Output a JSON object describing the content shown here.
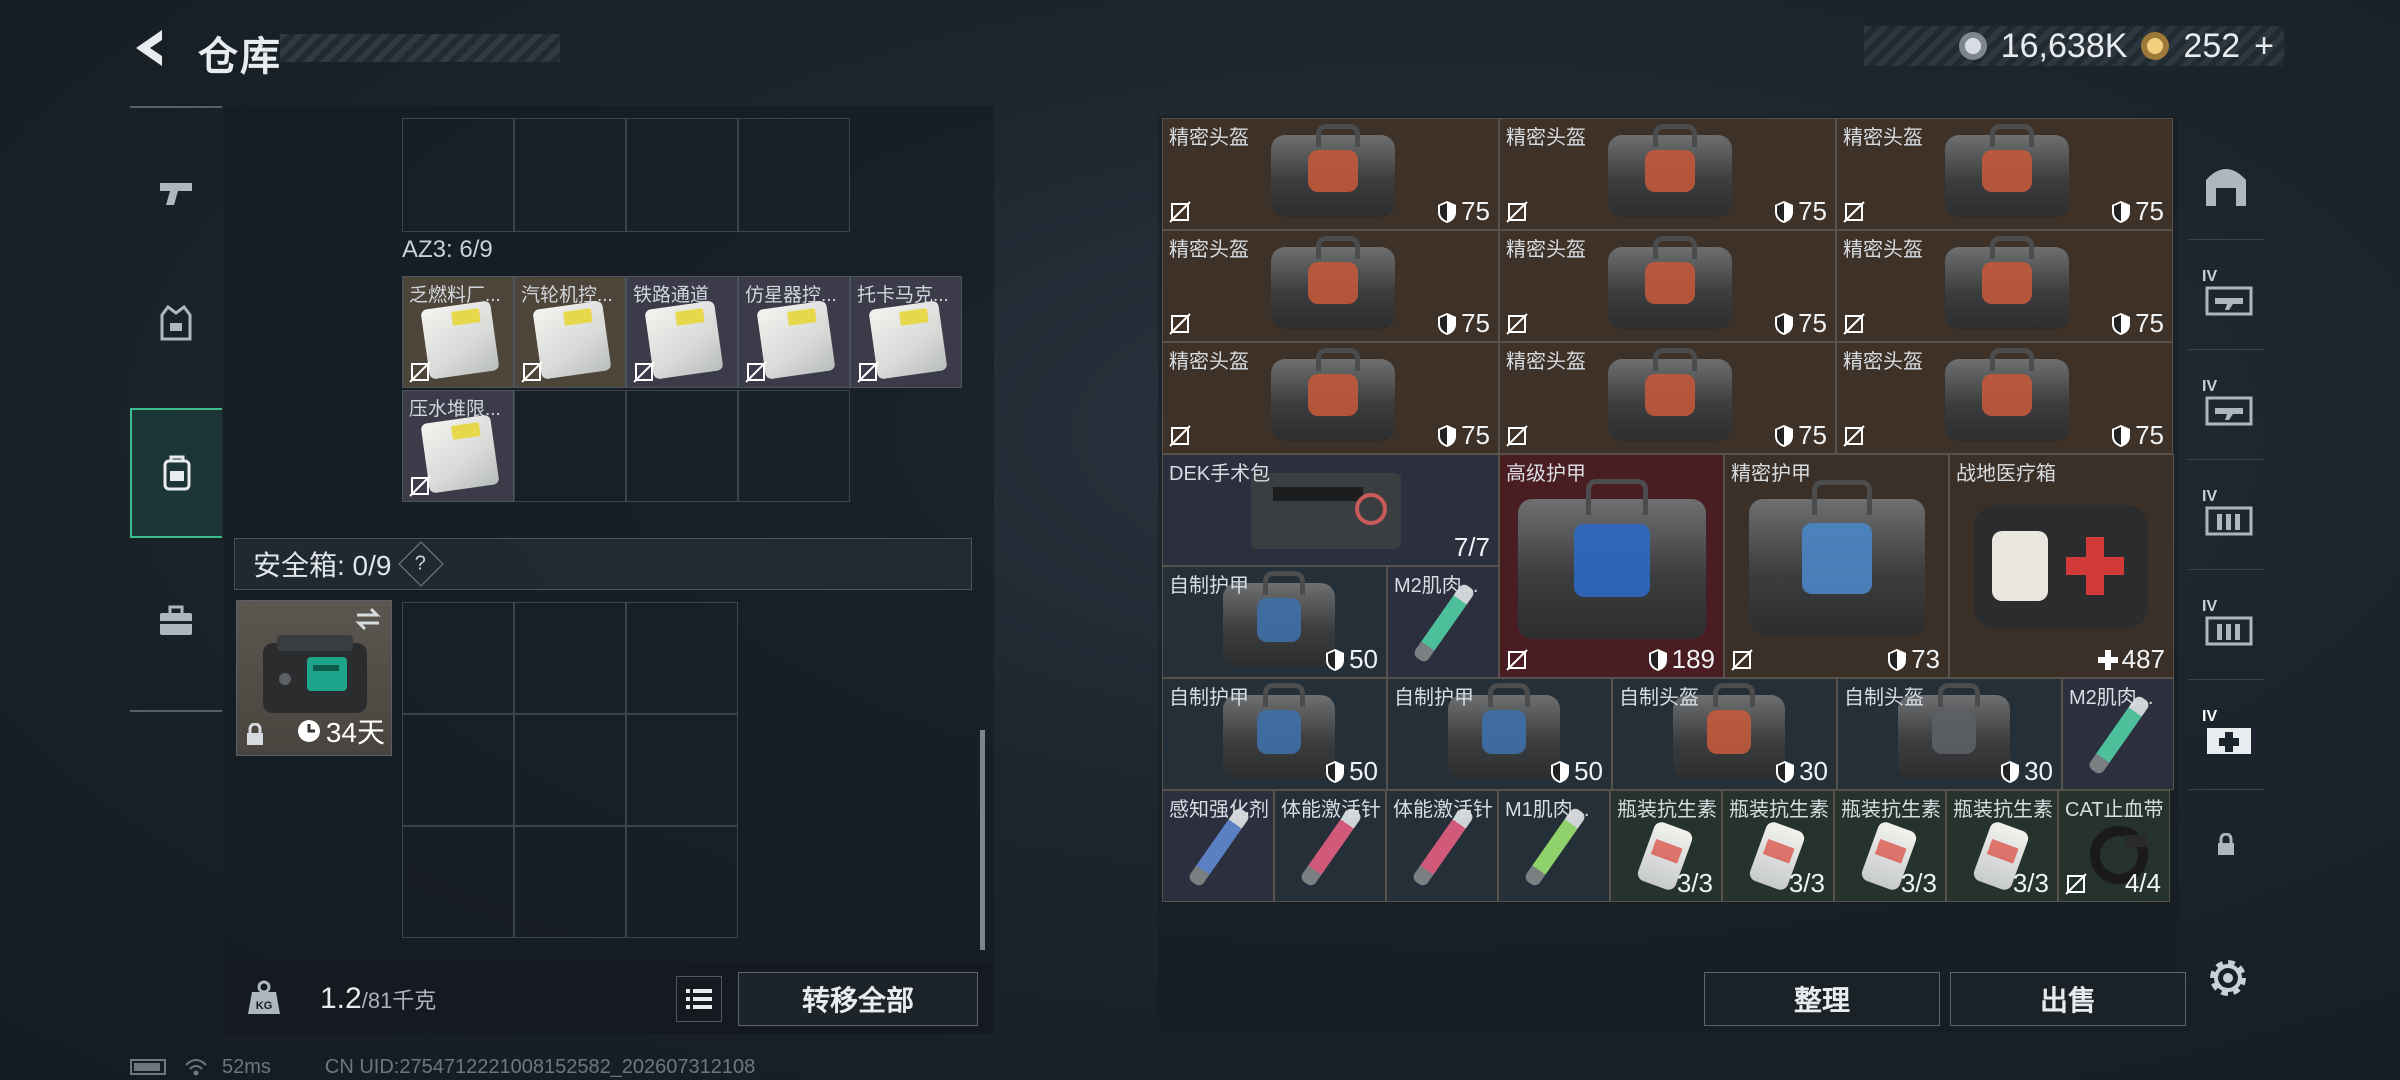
{
  "header": {
    "title": "仓库"
  },
  "currency": [
    {
      "icon": "silver-coin-icon",
      "value": "16,638K",
      "color": "#aab2b9"
    },
    {
      "icon": "gold-coin-icon",
      "value": "252",
      "color": "#c9a45c",
      "add": "+"
    }
  ],
  "side_nav": [
    {
      "name": "weapon",
      "icon": "pistol-icon"
    },
    {
      "name": "equipment",
      "icon": "vest-icon"
    },
    {
      "name": "backpack",
      "icon": "backpack-icon",
      "active": true
    },
    {
      "name": "case",
      "icon": "briefcase-icon"
    }
  ],
  "left": {
    "az3_label": "AZ3: 6/9",
    "az3_items": [
      "乏燃料厂...",
      "汽轮机控...",
      "铁路通道",
      "仿星器控...",
      "托卡马克...",
      "压水堆限..."
    ],
    "safebox_label": "安全箱: 0/9",
    "help": "?",
    "safebox_days": "34天",
    "weight_value": "1.2",
    "weight_max": "/81千克",
    "weight_icon_text": "KG",
    "transfer_all": "转移全部"
  },
  "status": {
    "ping": "52ms",
    "uid": "CN UID:2754712221008152582_202607312108"
  },
  "right": {
    "helmets": {
      "label": "精密头盔",
      "value": "75"
    },
    "row4": [
      {
        "label": "DEK手术包",
        "value": "7/7"
      },
      {
        "label": "高级护甲",
        "value": "189"
      },
      {
        "label": "精密护甲",
        "value": "73"
      },
      {
        "label": "战地医疗箱",
        "value": "487"
      }
    ],
    "row5": [
      {
        "label": "自制护甲",
        "value": "50"
      },
      {
        "label": "M2肌肉..."
      }
    ],
    "row6": [
      {
        "label": "自制护甲",
        "value": "50"
      },
      {
        "label": "自制护甲",
        "value": "50"
      },
      {
        "label": "自制头盔",
        "value": "30"
      },
      {
        "label": "自制头盔",
        "value": "30"
      },
      {
        "label": "M2肌肉..."
      }
    ],
    "row7": [
      {
        "label": "感知强化剂"
      },
      {
        "label": "体能激活针"
      },
      {
        "label": "体能激活针"
      },
      {
        "label": "M1肌肉..."
      },
      {
        "label": "瓶装抗生素",
        "value": "3/3"
      },
      {
        "label": "瓶装抗生素",
        "value": "3/3"
      },
      {
        "label": "瓶装抗生素",
        "value": "3/3"
      },
      {
        "label": "瓶装抗生素",
        "value": "3/3"
      },
      {
        "label": "CAT止血带",
        "value": "4/4"
      }
    ],
    "organize": "整理",
    "sell": "出售"
  },
  "right_tabs": [
    {
      "icon": "armor-tab-icon"
    },
    {
      "roman": "IV",
      "icon": "weapon-crate-icon"
    },
    {
      "roman": "IV",
      "icon": "weapon-crate-icon"
    },
    {
      "roman": "IV",
      "icon": "ammo-crate-icon"
    },
    {
      "roman": "IV",
      "icon": "ammo-crate-icon"
    },
    {
      "roman": "IV",
      "icon": "medical-crate-icon"
    },
    {
      "icon": "lock-icon"
    }
  ]
}
